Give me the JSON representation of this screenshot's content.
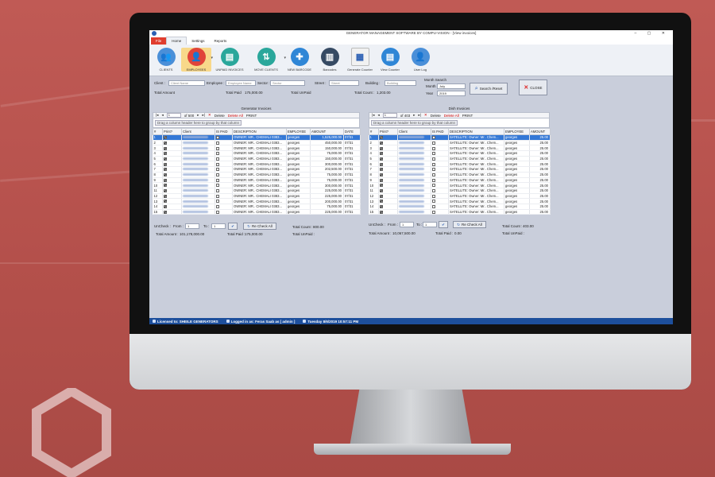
{
  "window": {
    "title": "GENERATOR MANAGEMENT SOFTWARE BY COMPU-VISION - [View invoices]",
    "controls": "–  ▢  ✕"
  },
  "menu": {
    "file": "File",
    "home": "Home",
    "settings": "Settings",
    "reports": "Reports"
  },
  "ribbon": [
    {
      "label": "CLIENTS",
      "icon": "clients-icon",
      "color": "#4a8fd8",
      "glyph": "👥"
    },
    {
      "label": "EMPLOYEES",
      "icon": "employees-icon",
      "color": "#e0443a",
      "glyph": "👤"
    },
    {
      "label": "UNPAID INVOICES",
      "icon": "unpaid-invoices-icon",
      "color": "#2aa79b",
      "glyph": "▤"
    },
    {
      "label": "MOVE CLIENTS",
      "icon": "move-clients-icon",
      "color": "#2aa79b",
      "glyph": "⇅"
    },
    {
      "label": "NEW BARCODE",
      "icon": "new-barcode-icon",
      "color": "#2f86d6",
      "glyph": "✚"
    },
    {
      "label": "Barcodes",
      "icon": "barcodes-icon",
      "color": "#364a63",
      "glyph": "▥"
    },
    {
      "label": "Generate Counter",
      "icon": "generate-counter-icon",
      "color": "#f1f1f1",
      "glyph": "▦"
    },
    {
      "label": "View Counter",
      "icon": "view-counter-icon",
      "color": "#2f86d6",
      "glyph": "▤"
    },
    {
      "label": "User Log",
      "icon": "user-log-icon",
      "color": "#4a8fd8",
      "glyph": "👤"
    }
  ],
  "filters": {
    "client_label": "Client :",
    "client_placeholder": "Client Name",
    "employee_label": "Employee :",
    "employee_placeholder": "Employee Name",
    "sector_label": "Sector :",
    "sector_placeholder": "Sector",
    "street_label": "Street :",
    "street_placeholder": "Street",
    "building_label": "Building :",
    "building_placeholder": "Building",
    "month_search_label": "Month Search",
    "month_label": "Month",
    "month_value": "July",
    "year_label": "Year",
    "year_value": "2019",
    "search_button": "Search /Reset",
    "close_button": "CLOSE"
  },
  "summary": {
    "total_amount_label": "Total Amount",
    "total_paid_label": "Total Paid",
    "total_paid_value": "175,000.00",
    "total_unpaid_label": "Total UnPaid",
    "total_count_label": "Total Count :",
    "total_count_value": "1,203.00"
  },
  "generator": {
    "title": "Generator Invoices",
    "page": "1",
    "of": "of 500",
    "delete": "Delete",
    "delete_all": "Delete All",
    "print": "PRINT",
    "group_hint": "Drag a column header here to group by that column",
    "columns": [
      "#",
      "Print?",
      "Client",
      "IS PAID",
      "DESCRIPTION",
      "EMPLOYEE",
      "AMOUNT",
      "DATE"
    ],
    "rows": [
      {
        "n": "1",
        "desc": "OWNER: MR.. CHEMALI 0383...",
        "emp": "georges",
        "amt": "1,525,000.00",
        "date": "07/31"
      },
      {
        "n": "2",
        "desc": "OWNER: MR.. CHEMALI 0383...",
        "emp": "georges",
        "amt": "450,000.00",
        "date": "07/31"
      },
      {
        "n": "3",
        "desc": "OWNER: MR.. CHEMALI 0383...",
        "emp": "georges",
        "amt": "150,000.00",
        "date": "07/31"
      },
      {
        "n": "4",
        "desc": "OWNER: MR.. CHEMALI 0383...",
        "emp": "georges",
        "amt": "75,000.00",
        "date": "07/31"
      },
      {
        "n": "5",
        "desc": "OWNER: MR.. CHEMALI 0383...",
        "emp": "georges",
        "amt": "150,000.00",
        "date": "07/31"
      },
      {
        "n": "6",
        "desc": "OWNER: MR.. CHEMALI 0383...",
        "emp": "georges",
        "amt": "300,000.00",
        "date": "07/31"
      },
      {
        "n": "7",
        "desc": "OWNER: MR.. CHEMALI 0383...",
        "emp": "georges",
        "amt": "202,500.00",
        "date": "07/31"
      },
      {
        "n": "8",
        "desc": "OWNER: MR.. CHEMALI 0383...",
        "emp": "georges",
        "amt": "75,000.00",
        "date": "07/31"
      },
      {
        "n": "9",
        "desc": "OWNER: MR.. CHEMALI 0383...",
        "emp": "georges",
        "amt": "75,000.00",
        "date": "07/31"
      },
      {
        "n": "10",
        "desc": "OWNER: MR.. CHEMALI 0383...",
        "emp": "georges",
        "amt": "300,000.00",
        "date": "07/31"
      },
      {
        "n": "11",
        "desc": "OWNER: MR.. CHEMALI 0383...",
        "emp": "georges",
        "amt": "225,000.00",
        "date": "07/31"
      },
      {
        "n": "12",
        "desc": "OWNER: MR.. CHEMALI 0383...",
        "emp": "georges",
        "amt": "225,000.00",
        "date": "07/31"
      },
      {
        "n": "13",
        "desc": "OWNER: MR.. CHEMALI 0383...",
        "emp": "georges",
        "amt": "200,000.00",
        "date": "07/31"
      },
      {
        "n": "14",
        "desc": "OWNER: MR.. CHEMALI 0383...",
        "emp": "georges",
        "amt": "75,000.00",
        "date": "07/31"
      },
      {
        "n": "15",
        "desc": "OWNER: MR.. CHEMALI 0383...",
        "emp": "georges",
        "amt": "225,000.00",
        "date": "07/31"
      }
    ],
    "uncheck_label": "UnCheck :",
    "from_label": "From :",
    "from_value": "1",
    "to_label": "To :",
    "to_value": "1",
    "recheck_button": "Re Check All",
    "total_count_label": "Total Count :",
    "total_count_value": "800.00",
    "total_amount_label": "Total Amount :",
    "total_amount_value": "101,178,000.00",
    "total_paid_label": "Total Paid :",
    "total_paid_value": "175,000.00",
    "total_unpaid_label": "Total UnPaid :"
  },
  "dish": {
    "title": "Dish Invoices",
    "page": "1",
    "of": "of 403",
    "delete": "Delete",
    "delete_all": "Delete All",
    "print": "PRINT",
    "group_hint": "Drag a column header here to group by that column",
    "columns": [
      "#",
      "Print?",
      "Client",
      "IS PAID",
      "DESCRIPTION",
      "EMPLOYEE",
      "AMOUNT"
    ],
    "rows": [
      {
        "n": "1",
        "desc": "SATELLITE: Owner: Mr.. Chem...",
        "emp": "georges",
        "amt": "25.00"
      },
      {
        "n": "2",
        "desc": "SATELLITE: Owner: Mr.. Chem...",
        "emp": "georges",
        "amt": "25.00"
      },
      {
        "n": "3",
        "desc": "SATELLITE: Owner: Mr.. Chem...",
        "emp": "georges",
        "amt": "25.00"
      },
      {
        "n": "4",
        "desc": "SATELLITE: Owner: Mr.. Chem...",
        "emp": "georges",
        "amt": "25.00"
      },
      {
        "n": "5",
        "desc": "SATELLITE: Owner: Mr.. Chem...",
        "emp": "georges",
        "amt": "25.00"
      },
      {
        "n": "6",
        "desc": "SATELLITE: Owner: Mr.. Chem...",
        "emp": "georges",
        "amt": "25.00"
      },
      {
        "n": "7",
        "desc": "SATELLITE: Owner: Mr.. Chem...",
        "emp": "georges",
        "amt": "25.00"
      },
      {
        "n": "8",
        "desc": "SATELLITE: Owner: Mr.. Chem...",
        "emp": "georges",
        "amt": "25.00"
      },
      {
        "n": "9",
        "desc": "SATELLITE: Owner: Mr.. Chem...",
        "emp": "georges",
        "amt": "25.00"
      },
      {
        "n": "10",
        "desc": "SATELLITE: Owner: Mr.. Chem...",
        "emp": "georges",
        "amt": "25.00"
      },
      {
        "n": "11",
        "desc": "SATELLITE: Owner: Mr.. Chem...",
        "emp": "georges",
        "amt": "25.00"
      },
      {
        "n": "12",
        "desc": "SATELLITE: Owner: Mr.. Chem...",
        "emp": "georges",
        "amt": "25.00"
      },
      {
        "n": "13",
        "desc": "SATELLITE: Owner: Mr.. Chem...",
        "emp": "georges",
        "amt": "25.00"
      },
      {
        "n": "14",
        "desc": "SATELLITE: Owner: Mr.. Chem...",
        "emp": "georges",
        "amt": "25.00"
      },
      {
        "n": "15",
        "desc": "SATELLITE: Owner: Mr.. Chem...",
        "emp": "georges",
        "amt": "25.00"
      }
    ],
    "uncheck_label": "UnCheck :",
    "from_label": "From :",
    "from_value": "1",
    "to_label": "To :",
    "to_value": "1",
    "recheck_button": "Re Check All",
    "total_count_label": "Total Count :",
    "total_count_value": "403.00",
    "total_amount_label": "Total Amount :",
    "total_amount_value": "10,067,500.00",
    "total_paid_label": "Total Paid :",
    "total_paid_value": "0.00",
    "total_unpaid_label": "Total UnPaid :"
  },
  "status": {
    "licensed": "Licensed to: SHEILE GENERATORS",
    "logged": "Logged in as: Feras Saab as [ admin ]",
    "datetime": "Tuesday 8/6/2019 10:57:11 PM"
  },
  "colors": {
    "accent": "#1d4f9c",
    "file_tab": "#e03d2e",
    "selection": "#3478d6",
    "background": "#b9524f"
  }
}
